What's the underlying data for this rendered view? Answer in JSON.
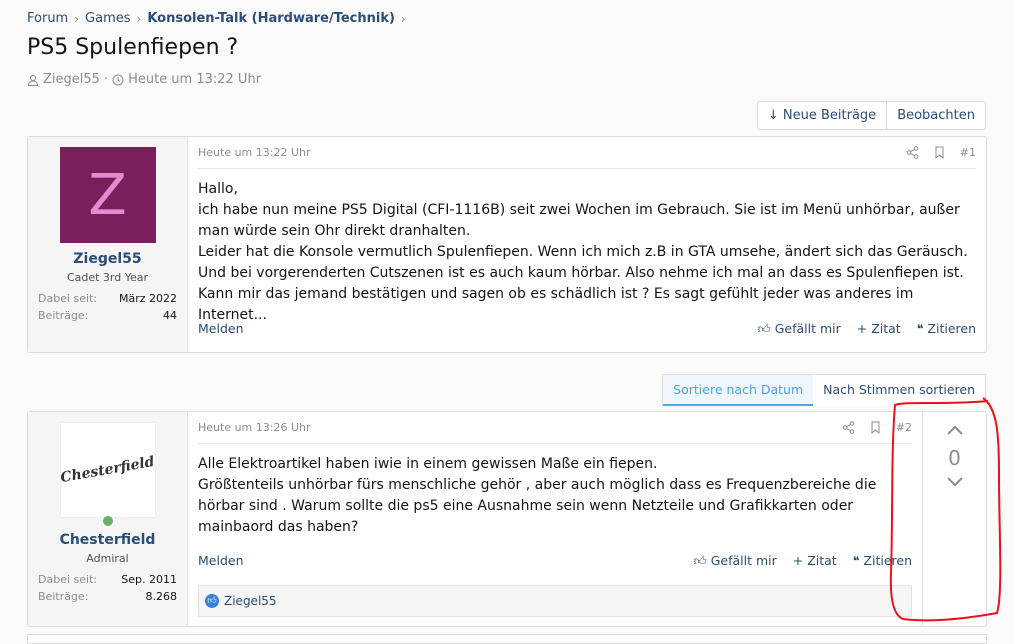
{
  "breadcrumb": {
    "items": [
      "Forum",
      "Games",
      "Konsolen-Talk (Hardware/Technik)"
    ]
  },
  "thread": {
    "title": "PS5 Spulenfiepen ?",
    "author": "Ziegel55",
    "time": "Heute um 13:22 Uhr"
  },
  "actions": {
    "new_posts": "↓ Neue Beiträge",
    "watch": "Beobachten"
  },
  "sort": {
    "by_date": "Sortiere nach Datum",
    "by_votes": "Nach Stimmen sortieren"
  },
  "posts": [
    {
      "avatar_letter": "Z",
      "avatar_color": "#7a1f5c",
      "username": "Ziegel55",
      "user_title": "Cadet 3rd Year",
      "joined_label": "Dabei seit:",
      "joined": "März 2022",
      "posts_label": "Beiträge:",
      "post_count": "44",
      "time": "Heute um 13:22 Uhr",
      "number": "#1",
      "lines": [
        "Hallo,",
        "ich habe nun meine PS5 Digital (CFI-1116B) seit zwei Wochen im Gebrauch. Sie ist im Menü unhörbar, außer man würde sein Ohr direkt dranhalten.",
        "Leider hat die Konsole vermutlich Spulenfiepen. Wenn ich mich z.B in GTA umsehe, ändert sich das Geräusch. Und bei vorgerenderten Cutszenen ist es auch kaum hörbar. Also nehme ich mal an dass es Spulenfiepen ist.",
        "Kann mir das jemand bestätigen und sagen ob es schädlich ist ? Es sagt gefühlt jeder was anderes im Internet..."
      ],
      "report": "Melden",
      "like": "Gefällt mir",
      "quote": "+ Zitat",
      "cite": "Zitieren"
    },
    {
      "avatar_text": "Chesterfield",
      "username": "Chesterfield",
      "user_title": "Admiral",
      "joined_label": "Dabei seit:",
      "joined": "Sep. 2011",
      "posts_label": "Beiträge:",
      "post_count": "8.268",
      "time": "Heute um 13:26 Uhr",
      "number": "#2",
      "lines": [
        "Alle Elektroartikel haben iwie in einem gewissen Maße ein fiepen.",
        "Größtenteils unhörbar fürs menschliche gehör , aber auch möglich dass es Frequenzbereiche die hörbar sind . Warum sollte die ps5 eine Ausnahme sein wenn Netzteile und Grafikkarten oder mainbaord das haben?"
      ],
      "report": "Melden",
      "like": "Gefällt mir",
      "quote": "+ Zitat",
      "cite": "Zitieren",
      "vote_score": "0",
      "liked_by": "Ziegel55"
    }
  ],
  "colors": {
    "link": "#2b4d78",
    "accent": "#47a7eb",
    "annotation": "#e8121d"
  }
}
